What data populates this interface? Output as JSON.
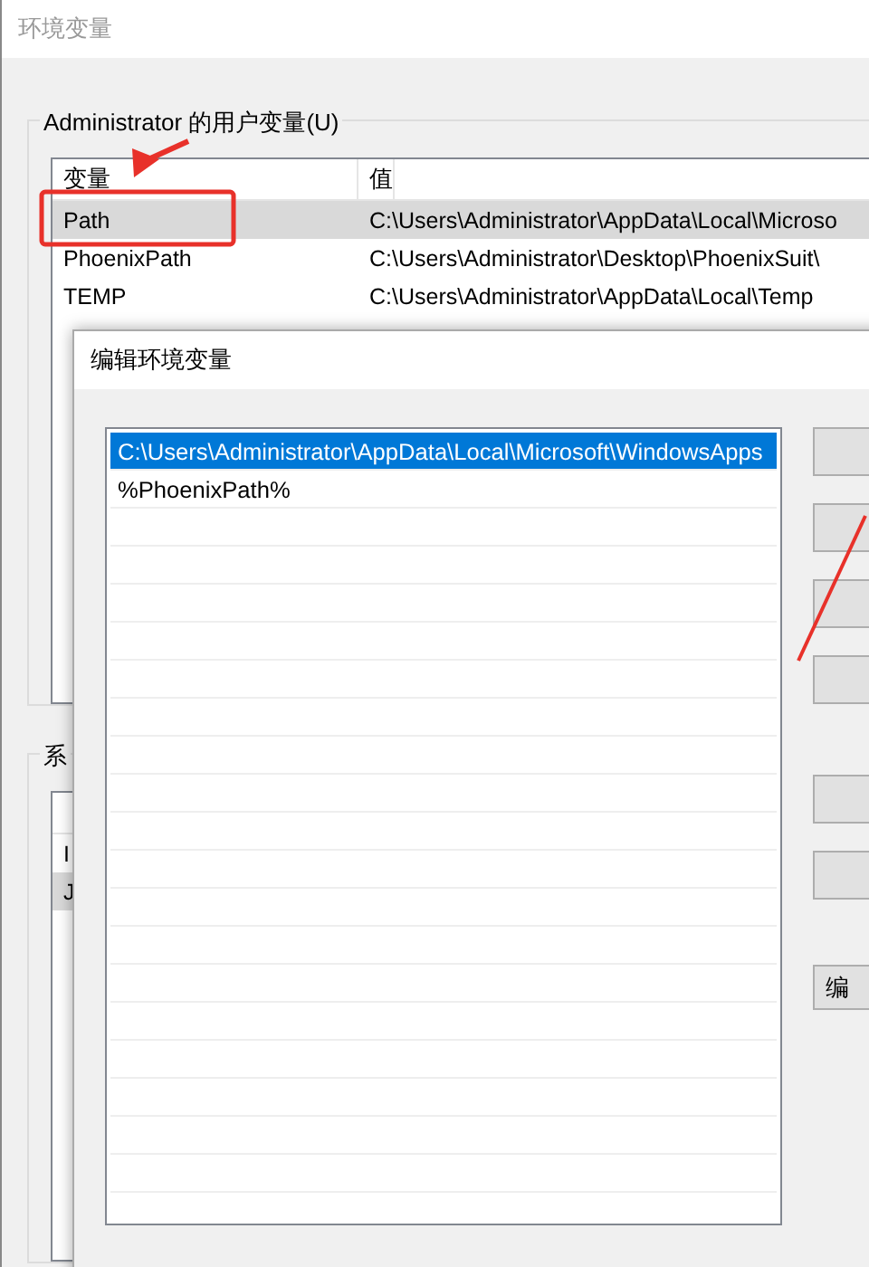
{
  "main_window": {
    "title": "环境变量",
    "user_group": {
      "label": "Administrator 的用户变量(U)",
      "columns": [
        "变量",
        "值"
      ],
      "rows": [
        {
          "name": "Path",
          "value": "C:\\Users\\Administrator\\AppData\\Local\\Microso",
          "selected": true
        },
        {
          "name": "PhoenixPath",
          "value": "C:\\Users\\Administrator\\Desktop\\PhoenixSuit\\",
          "selected": false
        },
        {
          "name": "TEMP",
          "value": "C:\\Users\\Administrator\\AppData\\Local\\Temp",
          "selected": false
        }
      ]
    },
    "system_group": {
      "label": "系",
      "rows": [
        {
          "name": "I",
          "selected": false
        },
        {
          "name": "J",
          "selected": true
        }
      ]
    }
  },
  "edit_dialog": {
    "title": "编辑环境变量",
    "entries": [
      {
        "text": "C:\\Users\\Administrator\\AppData\\Local\\Microsoft\\WindowsApps",
        "selected": true
      },
      {
        "text": "%PhoenixPath%",
        "selected": false
      }
    ],
    "edit_text_button": "编"
  }
}
